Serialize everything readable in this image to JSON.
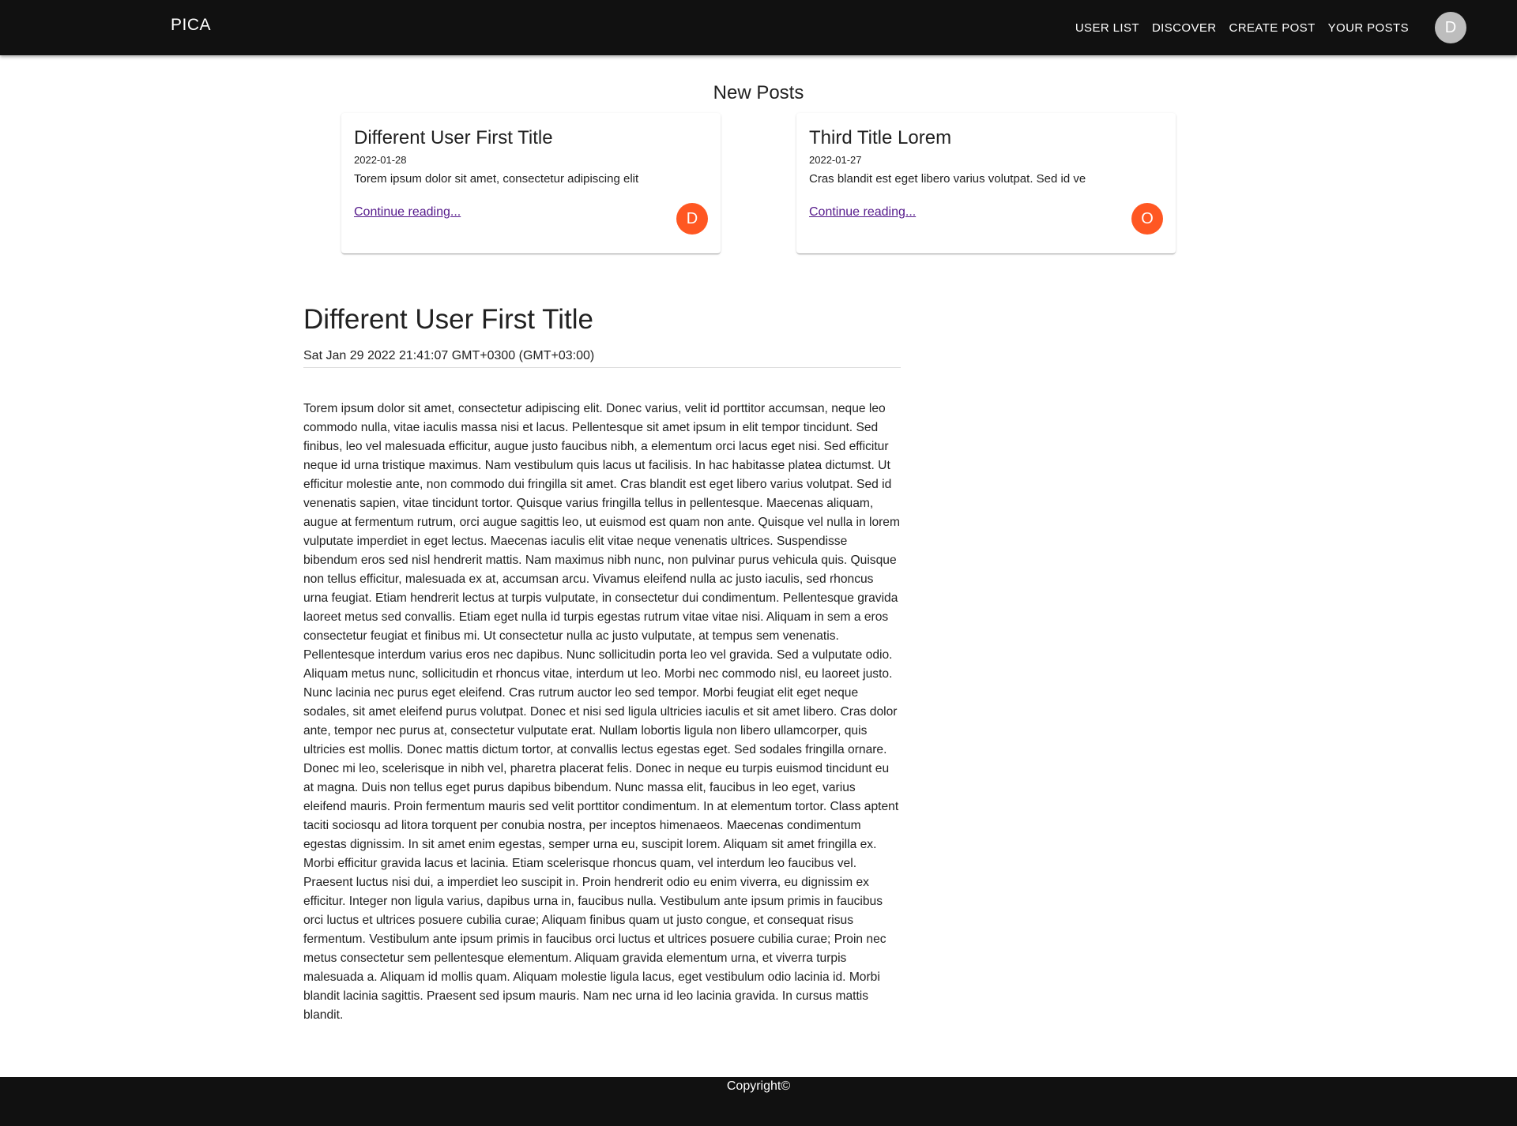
{
  "header": {
    "brand": "PICA",
    "nav": [
      "USER LIST",
      "DISCOVER",
      "CREATE POST",
      "YOUR POSTS"
    ],
    "avatar_letter": "D"
  },
  "new_posts": {
    "title": "New Posts",
    "cards": [
      {
        "title": "Different User First Title",
        "date": "2022-01-28",
        "excerpt": "Torem ipsum dolor sit amet, consectetur adipiscing elit",
        "link": "Continue reading...",
        "avatar_letter": "D"
      },
      {
        "title": "Third Title Lorem",
        "date": "2022-01-27",
        "excerpt": "Cras blandit est eget libero varius volutpat. Sed id ve",
        "link": "Continue reading...",
        "avatar_letter": "O"
      }
    ]
  },
  "article": {
    "title": "Different User First Title",
    "date": "Sat Jan 29 2022 21:41:07 GMT+0300 (GMT+03:00)",
    "body": "Torem ipsum dolor sit amet, consectetur adipiscing elit. Donec varius, velit id porttitor accumsan, neque leo commodo nulla, vitae iaculis massa nisi et lacus. Pellentesque sit amet ipsum in elit tempor tincidunt. Sed finibus, leo vel malesuada efficitur, augue justo faucibus nibh, a elementum orci lacus eget nisi. Sed efficitur neque id urna tristique maximus. Nam vestibulum quis lacus ut facilisis. In hac habitasse platea dictumst. Ut efficitur molestie ante, non commodo dui fringilla sit amet. Cras blandit est eget libero varius volutpat. Sed id venenatis sapien, vitae tincidunt tortor. Quisque varius fringilla tellus in pellentesque. Maecenas aliquam, augue at fermentum rutrum, orci augue sagittis leo, ut euismod est quam non ante. Quisque vel nulla in lorem vulputate imperdiet in eget lectus. Maecenas iaculis elit vitae neque venenatis ultrices. Suspendisse bibendum eros sed nisl hendrerit mattis. Nam maximus nibh nunc, non pulvinar purus vehicula quis. Quisque non tellus efficitur, malesuada ex at, accumsan arcu. Vivamus eleifend nulla ac justo iaculis, sed rhoncus urna feugiat. Etiam hendrerit lectus at turpis vulputate, in consectetur dui condimentum. Pellentesque gravida laoreet metus sed convallis. Etiam eget nulla id turpis egestas rutrum vitae vitae nisi. Aliquam in sem a eros consectetur feugiat et finibus mi. Ut consectetur nulla ac justo vulputate, at tempus sem venenatis. Pellentesque interdum varius eros nec dapibus. Nunc sollicitudin porta leo vel gravida. Sed a vulputate odio. Aliquam metus nunc, sollicitudin et rhoncus vitae, interdum ut leo. Morbi nec commodo nisl, eu laoreet justo. Nunc lacinia nec purus eget eleifend. Cras rutrum auctor leo sed tempor. Morbi feugiat elit eget neque sodales, sit amet eleifend purus volutpat. Donec et nisi sed ligula ultricies iaculis et sit amet libero. Cras dolor ante, tempor nec purus at, consectetur vulputate erat. Nullam lobortis ligula non libero ullamcorper, quis ultricies est mollis. Donec mattis dictum tortor, at convallis lectus egestas eget. Sed sodales fringilla ornare. Donec mi leo, scelerisque in nibh vel, pharetra placerat felis. Donec in neque eu turpis euismod tincidunt eu at magna. Duis non tellus eget purus dapibus bibendum. Nunc massa elit, faucibus in leo eget, varius eleifend mauris. Proin fermentum mauris sed velit porttitor condimentum. In at elementum tortor. Class aptent taciti sociosqu ad litora torquent per conubia nostra, per inceptos himenaeos. Maecenas condimentum egestas dignissim. In sit amet enim egestas, semper urna eu, suscipit lorem. Aliquam sit amet fringilla ex. Morbi efficitur gravida lacus et lacinia. Etiam scelerisque rhoncus quam, vel interdum leo faucibus vel. Praesent luctus nisi dui, a imperdiet leo suscipit in. Proin hendrerit odio eu enim viverra, eu dignissim ex efficitur. Integer non ligula varius, dapibus urna in, faucibus nulla. Vestibulum ante ipsum primis in faucibus orci luctus et ultrices posuere cubilia curae; Aliquam finibus quam ut justo congue, et consequat risus fermentum. Vestibulum ante ipsum primis in faucibus orci luctus et ultrices posuere cubilia curae; Proin nec metus consectetur sem pellentesque elementum. Aliquam gravida elementum urna, et viverra turpis malesuada a. Aliquam id mollis quam. Aliquam molestie ligula lacus, eget vestibulum odio lacinia id. Morbi blandit lacinia sagittis. Praesent sed ipsum mauris. Nam nec urna id leo lacinia gravida. In cursus mattis blandit."
  },
  "footer": {
    "text": "Copyright©"
  },
  "colors": {
    "header_bg": "#111111",
    "card_avatar_bg": "#ff5722",
    "header_avatar_bg": "#bdbdbd",
    "link": "#551a8b"
  }
}
